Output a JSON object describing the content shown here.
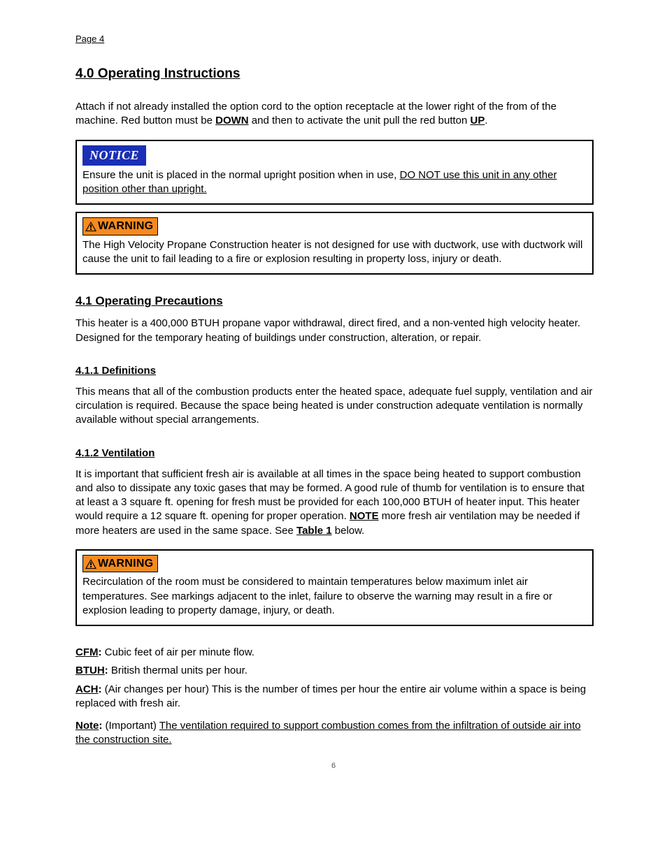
{
  "top_page_label": "Page 4",
  "section_4": {
    "heading": "4.0 Operating Instructions",
    "para1_pre": "Attach if not already installed the option cord to the option receptacle at the lower right of the from of the machine. Red button must be ",
    "para1_b1": "DOWN",
    "para1_mid": " and then to activate the unit pull the red button ",
    "para1_b2": "UP",
    "para1_end": ".",
    "notice_sentence_plain": "Ensure the unit is placed in the normal upright position when in use, ",
    "notice_sentence_uline": "DO NOT use this unit in any other position other than upright.",
    "warning_text": "The High Velocity Propane Construction heater is not designed for use with ductwork, use with ductwork will cause the unit to fail leading to a fire or explosion resulting in property loss, injury or death.",
    "subsec_41_heading": "4.1 Operating Precautions",
    "subsec_41_body": "This heater is a 400,000 BTUH propane vapor withdrawal, direct fired, and a non-vented high velocity heater. Designed for the temporary heating of buildings under construction, alteration, or repair.",
    "subsec_411_heading": "4.1.1 Definitions",
    "subsec_411_body": "This means that all of the combustion products enter the heated space, adequate fuel supply, ventilation and air circulation is required. Because the space being heated is under construction adequate ventilation is normally available without special arrangements.",
    "subsec_412_heading": "4.1.2 Ventilation",
    "subsec_412_body_pre": "It is important that sufficient fresh air is available at all times in the space being heated to support combustion and also to dissipate any toxic gases that may be formed. A good rule of thumb for ventilation is to ensure that at least a 3 square ft. opening for fresh must be provided for each 100,000 BTUH of heater input. This heater would require a 12 square ft. opening for proper operation. ",
    "subsec_412_body_b1": "NOTE",
    "subsec_412_body_post1": " more fresh air ventilation may be needed if more heaters are used in the same space. See ",
    "subsec_412_body_uline": "Table 1",
    "subsec_412_body_post2": " below.",
    "warning2_text": "Recirculation of the room must be considered to maintain temperatures below maximum inlet air temperatures. See markings adjacent to the inlet, failure to observe the warning may result in a fire or explosion leading to property damage, injury, or death.",
    "def_cfm_term": "CFM",
    "def_cfm_text": "Cubic feet of air per minute flow.",
    "def_btuh_term": "BTUH",
    "def_btuh_text": "British thermal units per hour.",
    "def_ach_term": "ACH",
    "def_ach_text": "(Air changes per hour) This is the number of times per hour the entire air volume within a space is being replaced with fresh air.",
    "note_leadword": "Note",
    "note_pre": "(Important) ",
    "note_uline": "The ventilation required to support combustion comes from the infiltration of outside air into the construction site.",
    "note_post": ""
  },
  "footer_page": "6"
}
